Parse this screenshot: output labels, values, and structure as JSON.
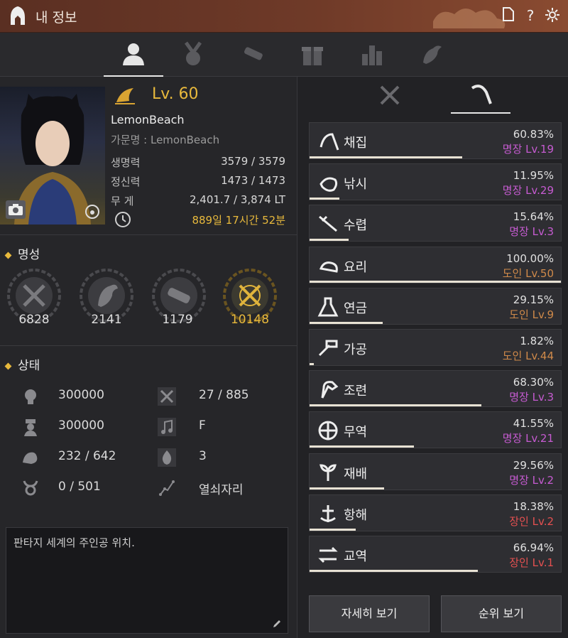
{
  "window": {
    "title": "내 정보"
  },
  "colors": {
    "gold": "#e8b93c",
    "master": "#c65bd1",
    "artisan": "#d08a4a",
    "apprentice": "#e45050"
  },
  "top_tabs": [
    {
      "icon": "profile-icon",
      "active": true
    },
    {
      "icon": "medal-icon",
      "active": false
    },
    {
      "icon": "scroll-icon",
      "active": false
    },
    {
      "icon": "gift-icon",
      "active": false
    },
    {
      "icon": "bar-chart-icon",
      "active": false
    },
    {
      "icon": "pet-icon",
      "active": false
    }
  ],
  "profile": {
    "level": "Lv. 60",
    "name": "LemonBeach",
    "family": "가문명 : LemonBeach",
    "stats": [
      {
        "label": "생명력",
        "value": "3579 / 3579"
      },
      {
        "label": "정신력",
        "value": "1473 / 1473"
      },
      {
        "label": "무 게",
        "value": "2,401.7 / 3,874 LT"
      }
    ],
    "playtime": "889일 17시간 52분"
  },
  "fame": {
    "title": "명성",
    "items": [
      {
        "icon": "combat-fame-icon",
        "value": "6828"
      },
      {
        "icon": "life-fame-icon",
        "value": "2141"
      },
      {
        "icon": "contribution-fame-icon",
        "value": "1179"
      },
      {
        "icon": "total-fame-icon",
        "value": "10148"
      }
    ]
  },
  "status": {
    "title": "상태",
    "left": [
      {
        "icon": "skill-icon",
        "value": "300000"
      },
      {
        "icon": "officer-icon",
        "value": "300000"
      },
      {
        "icon": "strength-icon",
        "value": "232 / 642"
      },
      {
        "icon": "taurus-icon",
        "value": "0 / 501"
      }
    ],
    "right": [
      {
        "icon": "crossed-tools-icon",
        "value": "27 / 885"
      },
      {
        "icon": "music-note-icon",
        "value": "F"
      },
      {
        "icon": "flame-icon",
        "value": "3"
      },
      {
        "icon": "constellation-icon",
        "value": "열쇠자리"
      }
    ]
  },
  "intro": {
    "text": "판타지 세계의 주인공 위치."
  },
  "life_skills": [
    {
      "name": "채집",
      "percent": "60.83%",
      "rank": "명장 Lv.19",
      "tier": "master",
      "fill": 0.6083
    },
    {
      "name": "낚시",
      "percent": "11.95%",
      "rank": "명장 Lv.29",
      "tier": "master",
      "fill": 0.1195
    },
    {
      "name": "수렵",
      "percent": "15.64%",
      "rank": "명장 Lv.3",
      "tier": "master",
      "fill": 0.1564
    },
    {
      "name": "요리",
      "percent": "100.00%",
      "rank": "도인 Lv.50",
      "tier": "artisan",
      "fill": 1.0
    },
    {
      "name": "연금",
      "percent": "29.15%",
      "rank": "도인 Lv.9",
      "tier": "artisan",
      "fill": 0.2915
    },
    {
      "name": "가공",
      "percent": "1.82%",
      "rank": "도인 Lv.44",
      "tier": "artisan",
      "fill": 0.0182
    },
    {
      "name": "조련",
      "percent": "68.30%",
      "rank": "명장 Lv.3",
      "tier": "master",
      "fill": 0.683
    },
    {
      "name": "무역",
      "percent": "41.55%",
      "rank": "명장 Lv.21",
      "tier": "master",
      "fill": 0.4155
    },
    {
      "name": "재배",
      "percent": "29.56%",
      "rank": "명장 Lv.2",
      "tier": "master",
      "fill": 0.2956
    },
    {
      "name": "항해",
      "percent": "18.38%",
      "rank": "장인 Lv.2",
      "tier": "apprentice",
      "fill": 0.1838
    },
    {
      "name": "교역",
      "percent": "66.94%",
      "rank": "장인 Lv.1",
      "tier": "apprentice",
      "fill": 0.6694
    }
  ],
  "buttons": {
    "detail": "자세히 보기",
    "ranking": "순위 보기"
  }
}
